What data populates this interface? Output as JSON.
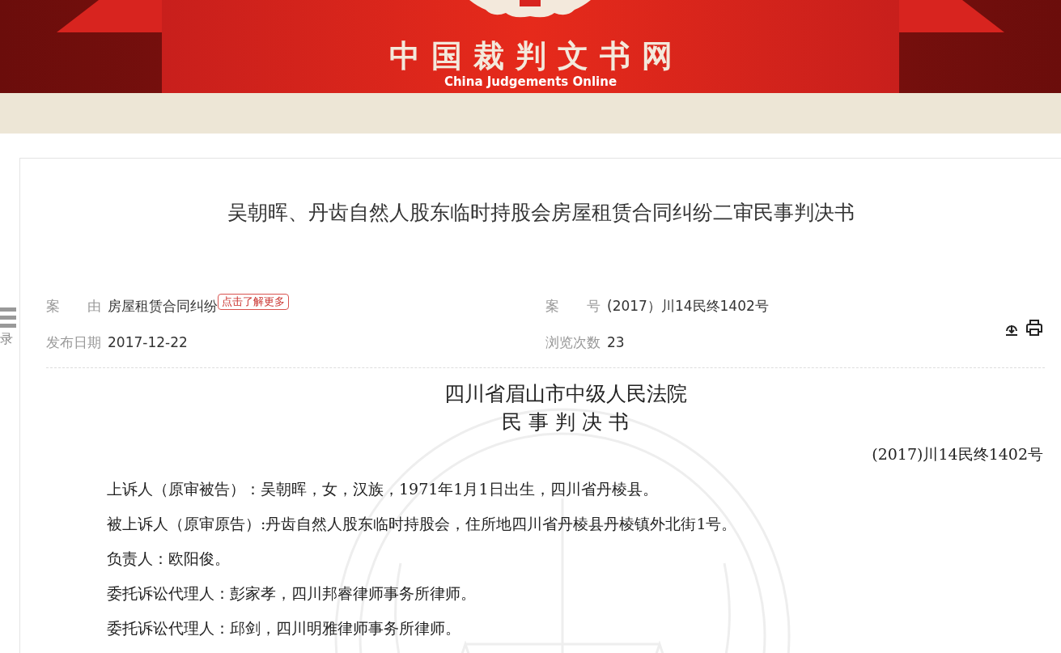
{
  "header": {
    "logo_title": "中国裁判文书网",
    "logo_subtitle": "China Judgements Online"
  },
  "sidebar_toggle": {
    "label": "录"
  },
  "document": {
    "title": "吴朝晖、丹齿自然人股东临时持股会房屋租赁合同纠纷二审民事判决书",
    "meta": [
      {
        "label": "案　　由",
        "value": "房屋租赁合同纠纷",
        "tag": "点击了解更多"
      },
      {
        "label": "案　　号",
        "value": "(2017）川14民终1402号"
      },
      {
        "label": "发布日期",
        "value": "2017-12-22"
      },
      {
        "label": "浏览次数",
        "value": "23"
      }
    ],
    "court": "四川省眉山市中级人民法院",
    "doc_type": "民 事 判 决 书",
    "case_number": "(2017)川14民终1402号",
    "paragraphs": [
      "上诉人（原审被告）：吴朝晖，女，汉族，1971年1月1日出生，四川省丹棱县。",
      "被上诉人（原审原告）:丹齿自然人股东临时持股会，住所地四川省丹棱县丹棱镇外北街1号。",
      "负责人：欧阳俊。",
      "委托诉讼代理人：彭家孝，四川邦睿律师事务所律师。",
      "委托诉讼代理人：邱剑，四川明雅律师事务所律师。"
    ]
  }
}
